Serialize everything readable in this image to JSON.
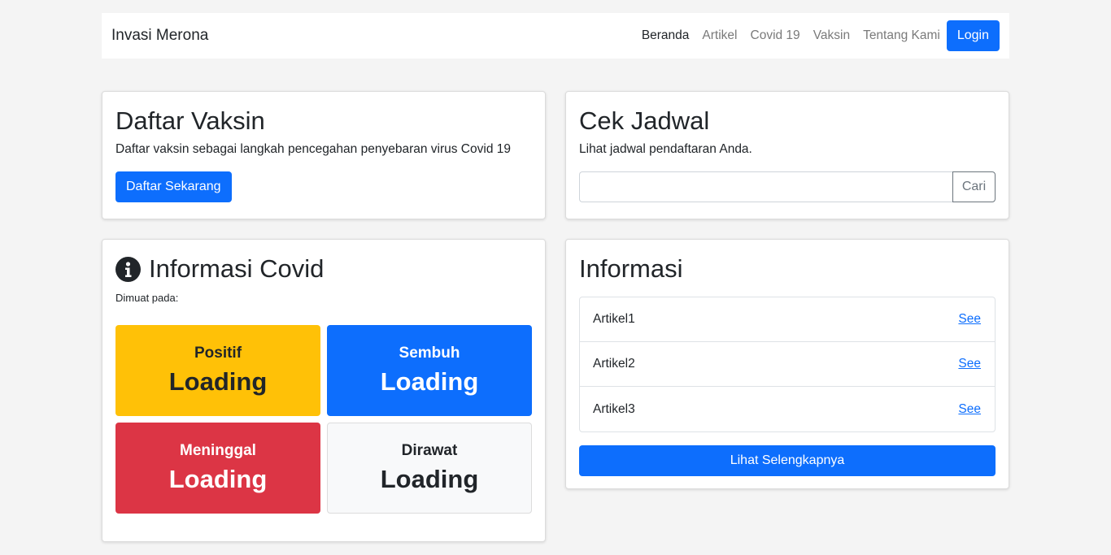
{
  "navbar": {
    "brand": "Invasi Merona",
    "links": [
      {
        "label": "Beranda",
        "active": true
      },
      {
        "label": "Artikel"
      },
      {
        "label": "Covid 19"
      },
      {
        "label": "Vaksin"
      },
      {
        "label": "Tentang Kami"
      }
    ],
    "login_label": "Login"
  },
  "daftar": {
    "title": "Daftar Vaksin",
    "description": "Daftar vaksin sebagai langkah pencegahan penyebaran virus Covid 19",
    "button_label": "Daftar Sekarang"
  },
  "cek": {
    "title": "Cek Jadwal",
    "description": "Lihat jadwal pendaftaran Anda.",
    "input_value": "",
    "button_label": "Cari"
  },
  "covid": {
    "title": "Informasi Covid",
    "loaded_label": "Dimuat pada:",
    "stats": [
      {
        "label": "Positif",
        "value": "Loading"
      },
      {
        "label": "Sembuh",
        "value": "Loading"
      },
      {
        "label": "Meninggal",
        "value": "Loading"
      },
      {
        "label": "Dirawat",
        "value": "Loading"
      }
    ]
  },
  "informasi": {
    "title": "Informasi",
    "articles": [
      {
        "title": "Artikel1",
        "link": "See"
      },
      {
        "title": "Artikel2",
        "link": "See"
      },
      {
        "title": "Artikel3",
        "link": "See"
      }
    ],
    "more_label": "Lihat Selengkapnya"
  },
  "colors": {
    "primary": "#0d6efd",
    "warning": "#ffc107",
    "danger": "#dc3545",
    "light": "#f8f9fa",
    "background": "#f4f4f4"
  },
  "icons": {
    "covid_title": "info-circle-icon"
  }
}
